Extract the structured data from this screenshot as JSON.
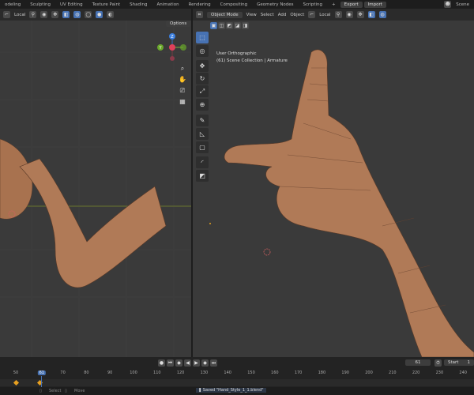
{
  "workspaces": [
    "odeling",
    "Sculpting",
    "UV Editing",
    "Texture Paint",
    "Shading",
    "Animation",
    "Rendering",
    "Compositing",
    "Geometry Nodes",
    "Scripting"
  ],
  "add_workspace": "+",
  "export_label": "Export",
  "import_label": "Import",
  "scene_label": "Scene",
  "left_header": {
    "pivot": "Local",
    "options": "Options"
  },
  "right_header": {
    "mode": "Object Mode",
    "menus": [
      "View",
      "Select",
      "Add",
      "Object"
    ],
    "pivot": "Local"
  },
  "viewport_info": {
    "view": "User Orthographic",
    "collection": "(61) Scene Collection | Armature"
  },
  "gizmo": {
    "z": "Z",
    "y": "Y",
    "x": "X"
  },
  "timeline": {
    "current_frame": "61",
    "frame_field": "61",
    "start_label": "Start",
    "start_value": "1",
    "ticks": [
      "50",
      "61",
      "70",
      "80",
      "90",
      "100",
      "110",
      "120",
      "130",
      "140",
      "150",
      "160",
      "170",
      "180",
      "190",
      "200",
      "210",
      "220",
      "230",
      "240"
    ]
  },
  "status": {
    "select": "Select",
    "move": "Move",
    "message": "Saved \"Hand_Style_1_1.blend\""
  },
  "colors": {
    "accent": "#4772b3",
    "skin": "#b07a57",
    "viewport": "#3a3a3a"
  }
}
